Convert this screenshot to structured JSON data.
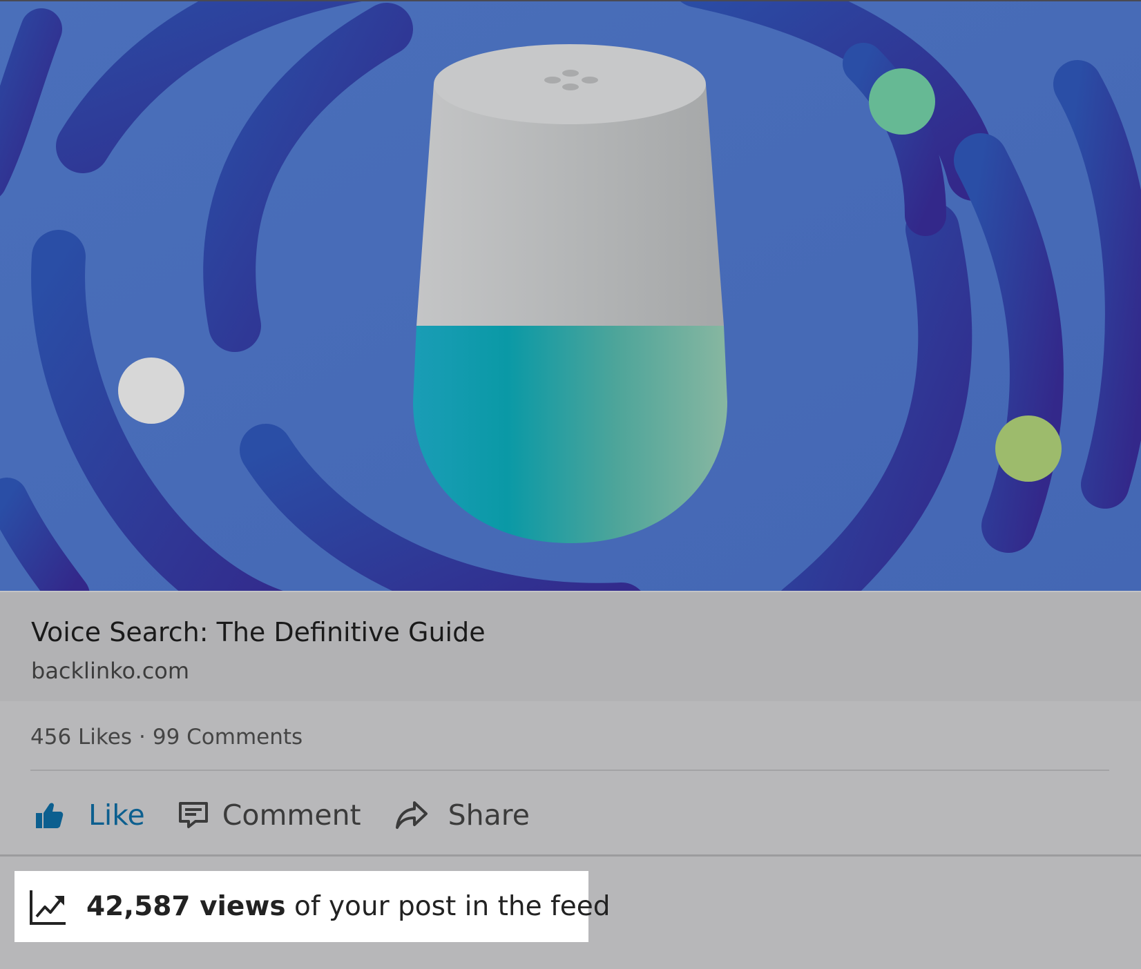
{
  "hero": {
    "image_description_icon": "smart-speaker-illustration",
    "colors": {
      "background": "#466fb8",
      "rings": "#2e3fa0",
      "speaker_top": "#b9bbbc",
      "speaker_bottom": "#1aa3ae",
      "dot_green": "#66b994",
      "dot_lime": "#9dbb6c",
      "dot_white": "#d5d5d5"
    }
  },
  "link": {
    "title": "Voice Search: The Definitive Guide",
    "domain": "backlinko.com"
  },
  "engagement": {
    "likes": "456 Likes",
    "separator": "·",
    "comments": "99 Comments"
  },
  "actions": {
    "like": {
      "label": "Like",
      "icon": "thumbs-up-icon",
      "color": "#0c5f8f"
    },
    "comment": {
      "label": "Comment",
      "icon": "comment-icon"
    },
    "share": {
      "label": "Share",
      "icon": "share-arrow-icon"
    }
  },
  "views": {
    "icon": "trending-up-chart-icon",
    "count": "42,587 views",
    "suffix": " of your post in the feed"
  }
}
